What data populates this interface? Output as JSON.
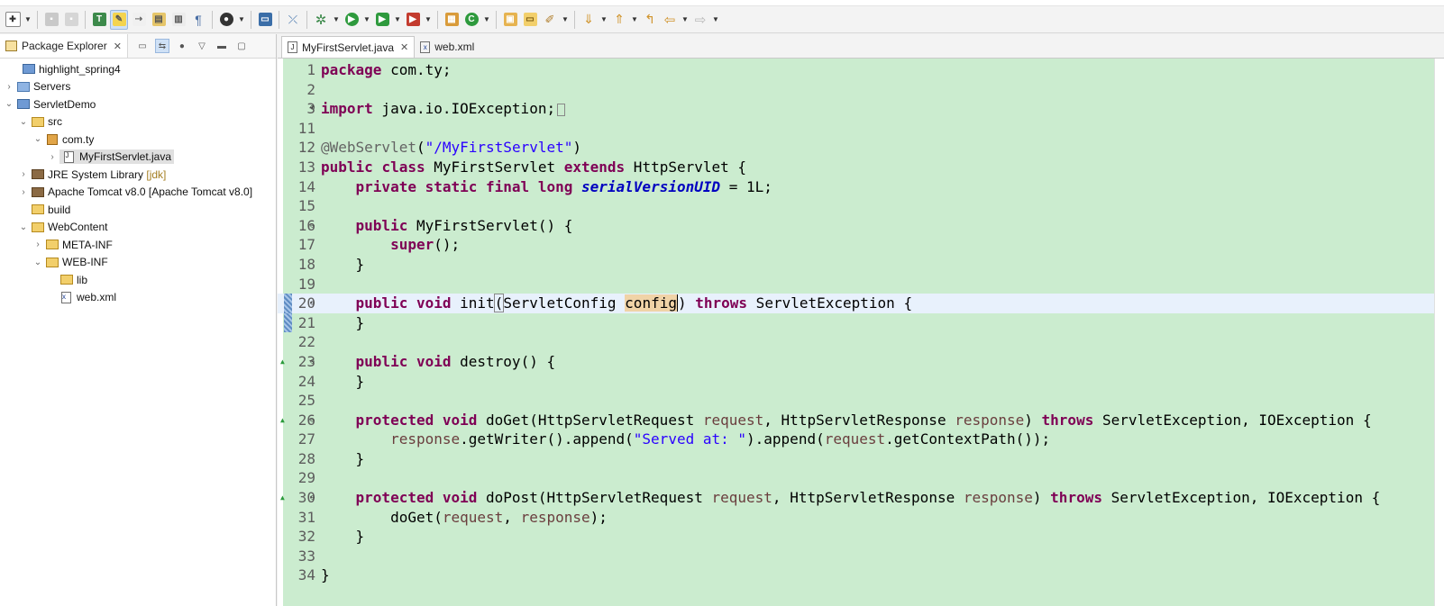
{
  "explorer": {
    "title": "Package Explorer",
    "items": [
      {
        "label": "highlight_spring4",
        "decor": ""
      },
      {
        "label": "Servers",
        "decor": ""
      },
      {
        "label": "ServletDemo",
        "decor": ""
      },
      {
        "label": "src",
        "decor": ""
      },
      {
        "label": "com.ty",
        "decor": ""
      },
      {
        "label": "MyFirstServlet.java",
        "decor": ""
      },
      {
        "label": "JRE System Library",
        "decor": "[jdk]"
      },
      {
        "label": "Apache Tomcat v8.0",
        "decor": "[Apache Tomcat v8.0]"
      },
      {
        "label": "build",
        "decor": ""
      },
      {
        "label": "WebContent",
        "decor": ""
      },
      {
        "label": "META-INF",
        "decor": ""
      },
      {
        "label": "WEB-INF",
        "decor": ""
      },
      {
        "label": "lib",
        "decor": ""
      },
      {
        "label": "web.xml",
        "decor": ""
      }
    ]
  },
  "editor": {
    "tabs": [
      {
        "label": "MyFirstServlet.java"
      },
      {
        "label": "web.xml"
      }
    ],
    "line_numbers": [
      "1",
      "2",
      "3",
      "11",
      "12",
      "13",
      "14",
      "15",
      "16",
      "17",
      "18",
      "19",
      "20",
      "21",
      "22",
      "23",
      "24",
      "25",
      "26",
      "27",
      "28",
      "29",
      "30",
      "31",
      "32",
      "33",
      "34"
    ],
    "code": {
      "l1_kw": "package",
      "l1_rest": " com.ty;",
      "l3_kw": "import",
      "l3_rest": " java.io.IOException;",
      "l11_ann": "@WebServlet",
      "l11_p1": "(",
      "l11_str": "\"/MyFirstServlet\"",
      "l11_p2": ")",
      "l12_kw1": "public",
      "l12_kw2": "class",
      "l12_t1": " MyFirstServlet ",
      "l12_kw3": "extends",
      "l12_t2": " HttpServlet {",
      "l13_kw": "private static final long",
      "l13_fld": "serialVersionUID",
      "l13_rest": " = 1L;",
      "l15_kw": "public",
      "l15_rest": " MyFirstServlet() {",
      "l16_kw": "super",
      "l16_rest": "();",
      "brace_close": "}",
      "l19_kw": "public void",
      "l19_t1": " init",
      "l19_p": "(",
      "l19_t2": "ServletConfig ",
      "l19_param": "config",
      "l19_p2": ")",
      "l19_kw2": "throws",
      "l19_t3": " ServletException {",
      "l22_kw": "public void",
      "l22_rest": " destroy() {",
      "l25_kw": "protected void",
      "l25_t1": " doGet(HttpServletRequest ",
      "l25_p1": "request",
      "l25_t2": ", HttpServletResponse ",
      "l25_p2": "response",
      "l25_t3": ") ",
      "l25_kw2": "throws",
      "l25_t4": " ServletException, IOException {",
      "l26_p1": "response",
      "l26_t1": ".getWriter().append(",
      "l26_str": "\"Served at: \"",
      "l26_t2": ").append(",
      "l26_p2": "request",
      "l26_t3": ".getContextPath());",
      "l29_kw": "protected void",
      "l29_t1": " doPost(HttpServletRequest ",
      "l29_p1": "request",
      "l29_t2": ", HttpServletResponse ",
      "l29_p2": "response",
      "l29_t3": ") ",
      "l29_kw2": "throws",
      "l29_t4": " ServletException, IOException {",
      "l30_t1": "doGet(",
      "l30_p1": "request",
      "l30_t2": ", ",
      "l30_p2": "response",
      "l30_t3": ");"
    }
  },
  "colors": {
    "editor_bg": "#cbeccf",
    "keyword": "#7f0055",
    "string": "#2a00ff",
    "field": "#0000c0",
    "current_line": "#e8f1fc"
  }
}
